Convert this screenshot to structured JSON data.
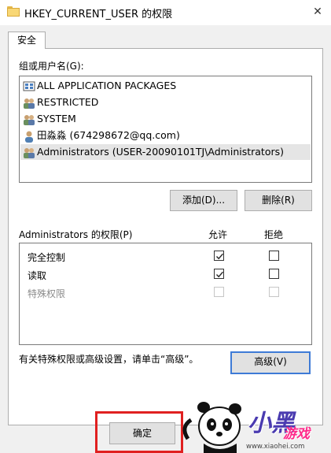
{
  "window": {
    "title": "HKEY_CURRENT_USER 的权限",
    "close_glyph": "✕"
  },
  "tabs": [
    {
      "label": "安全"
    }
  ],
  "groups": {
    "label": "组或用户名(G):",
    "items": [
      {
        "label": "ALL APPLICATION PACKAGES",
        "icon": "app-packages-icon"
      },
      {
        "label": "RESTRICTED",
        "icon": "group-icon"
      },
      {
        "label": "SYSTEM",
        "icon": "group-icon"
      },
      {
        "label": "田淼淼 (674298672@qq.com)",
        "icon": "user-icon"
      },
      {
        "label": "Administrators (USER-20090101TJ\\Administrators)",
        "icon": "group-icon",
        "selected": true
      }
    ]
  },
  "buttons": {
    "add": "添加(D)...",
    "remove": "删除(R)",
    "advanced": "高级(V)",
    "ok": "确定"
  },
  "permissions": {
    "title": "Administrators 的权限(P)",
    "allow_header": "允许",
    "deny_header": "拒绝",
    "rows": [
      {
        "label": "完全控制",
        "allow": true,
        "deny": false,
        "disabled": false
      },
      {
        "label": "读取",
        "allow": true,
        "deny": false,
        "disabled": false
      },
      {
        "label": "特殊权限",
        "allow": false,
        "deny": false,
        "disabled": true
      }
    ]
  },
  "advanced_hint": "有关特殊权限或高级设置，请单击“高级”。",
  "watermark": {
    "logo_text": "小黑",
    "game_text": "游戏",
    "url": "www.xiaohei.com"
  },
  "colors": {
    "highlight_border": "#e02020",
    "focus_border": "#3e7bd6",
    "selection_bg": "#e5e5e5"
  }
}
